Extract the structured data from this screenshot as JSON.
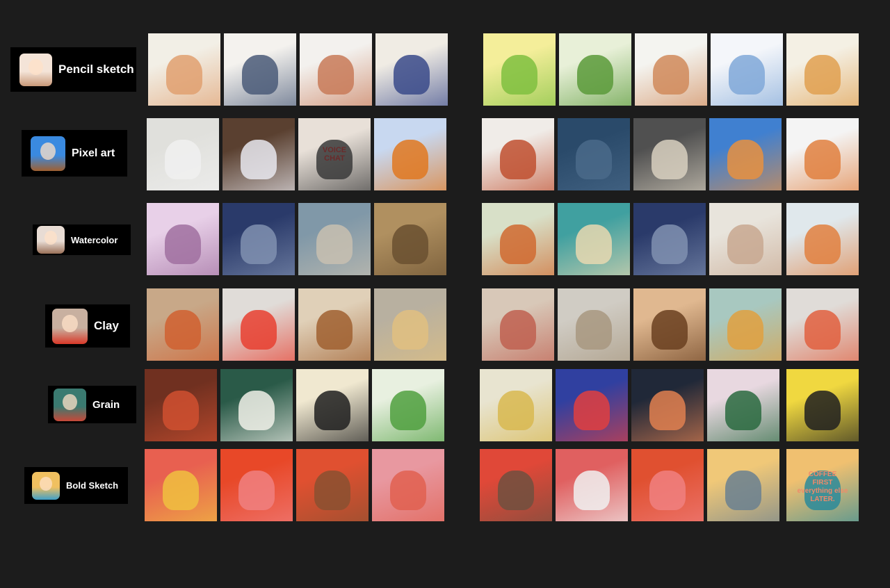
{
  "styles": [
    {
      "label": "Pencil sketch",
      "avatar": [
        "#f4e4d8",
        "#c89878"
      ],
      "tiles": [
        [
          "#f2efe6",
          "#e0a070"
        ],
        [
          "#f4f2ee",
          "#4a5a78"
        ],
        [
          "#f3f1ee",
          "#c87a58"
        ],
        [
          "#f0ece4",
          "#3a4a8a"
        ],
        [
          "#f4ee9a",
          "#7fc040"
        ],
        [
          "#e8f0d8",
          "#5a9a3a"
        ],
        [
          "#f4f4f0",
          "#d08a5a"
        ],
        [
          "#f4f6fa",
          "#80a8d8"
        ],
        [
          "#f4f0e4",
          "#e0a050"
        ]
      ]
    },
    {
      "label": "Pixel art",
      "avatar": [
        "#3a8ae0",
        "#a06030"
      ],
      "tiles": [
        [
          "#e0e0dc",
          "#f0f0f0"
        ],
        [
          "#5a4030",
          "#e8e8ee"
        ],
        [
          "#e8e0d8",
          "#3a3a3a"
        ],
        [
          "#c8d8f0",
          "#e07820"
        ],
        [
          "#f0ece8",
          "#c05030"
        ],
        [
          "#2a4a6a",
          "#4a6a8a"
        ],
        [
          "#505050",
          "#d8d0c0"
        ],
        [
          "#4080d0",
          "#e89040"
        ],
        [
          "#f4f4f4",
          "#e08040"
        ]
      ]
    },
    {
      "label": "Watercolor",
      "avatar": [
        "#e8dcd4",
        "#9a7058"
      ],
      "tiles": [
        [
          "#e8d0e8",
          "#a070a0"
        ],
        [
          "#2a3a6a",
          "#8090b0"
        ],
        [
          "#8098a8",
          "#c8c0b0"
        ],
        [
          "#b09060",
          "#6a5030"
        ],
        [
          "#d8e0c8",
          "#d06a30"
        ],
        [
          "#40a0a0",
          "#e8d8b0"
        ],
        [
          "#2a3a6a",
          "#8090b0"
        ],
        [
          "#e8e4dc",
          "#c8a890"
        ],
        [
          "#e0e8ec",
          "#e08040"
        ]
      ]
    },
    {
      "label": "Clay",
      "avatar": [
        "#c8b0a0",
        "#d83828"
      ],
      "tiles": [
        [
          "#c8a888",
          "#d06030"
        ],
        [
          "#e0dcd8",
          "#e84030"
        ],
        [
          "#e0d0b8",
          "#a06030"
        ],
        [
          "#b8b0a0",
          "#e0c080"
        ],
        [
          "#d8c8b8",
          "#c06050"
        ],
        [
          "#d0ccc4",
          "#a89880"
        ],
        [
          "#e0b890",
          "#6a4020"
        ],
        [
          "#a8c8c0",
          "#e0a040"
        ],
        [
          "#e0dcd8",
          "#e06040"
        ]
      ]
    },
    {
      "label": "Grain",
      "avatar": [
        "#3a7a70",
        "#c84838"
      ],
      "tiles": [
        [
          "#703020",
          "#d05030"
        ],
        [
          "#2a5a48",
          "#f0f0e8"
        ],
        [
          "#f0e8d0",
          "#202020"
        ],
        [
          "#e8f0e0",
          "#50a040"
        ],
        [
          "#e8e4d0",
          "#d8b850"
        ],
        [
          "#3040a0",
          "#e04040"
        ],
        [
          "#202838",
          "#e08050"
        ],
        [
          "#e8d8e0",
          "#2a6a40"
        ],
        [
          "#f0d840",
          "#202020"
        ]
      ]
    },
    {
      "label": "Bold Sketch",
      "avatar": [
        "#f0c060",
        "#40a0c8"
      ],
      "tiles": [
        [
          "#e86050",
          "#f0c040"
        ],
        [
          "#e84828",
          "#f08080"
        ],
        [
          "#e05030",
          "#8a5030"
        ],
        [
          "#e898a0",
          "#e06050"
        ],
        [
          "#e04838",
          "#705040"
        ],
        [
          "#e06060",
          "#f0f0f0"
        ],
        [
          "#e05030",
          "#f08080"
        ],
        [
          "#f0c878",
          "#6a8090"
        ],
        [
          "#f0c070",
          "#2a8a9a"
        ]
      ]
    }
  ],
  "image_text": {
    "pixel_sign": "VOICE\nCHAT",
    "coffee_mug": "COFFEE\nFIRST\neverything else\nLATER."
  }
}
